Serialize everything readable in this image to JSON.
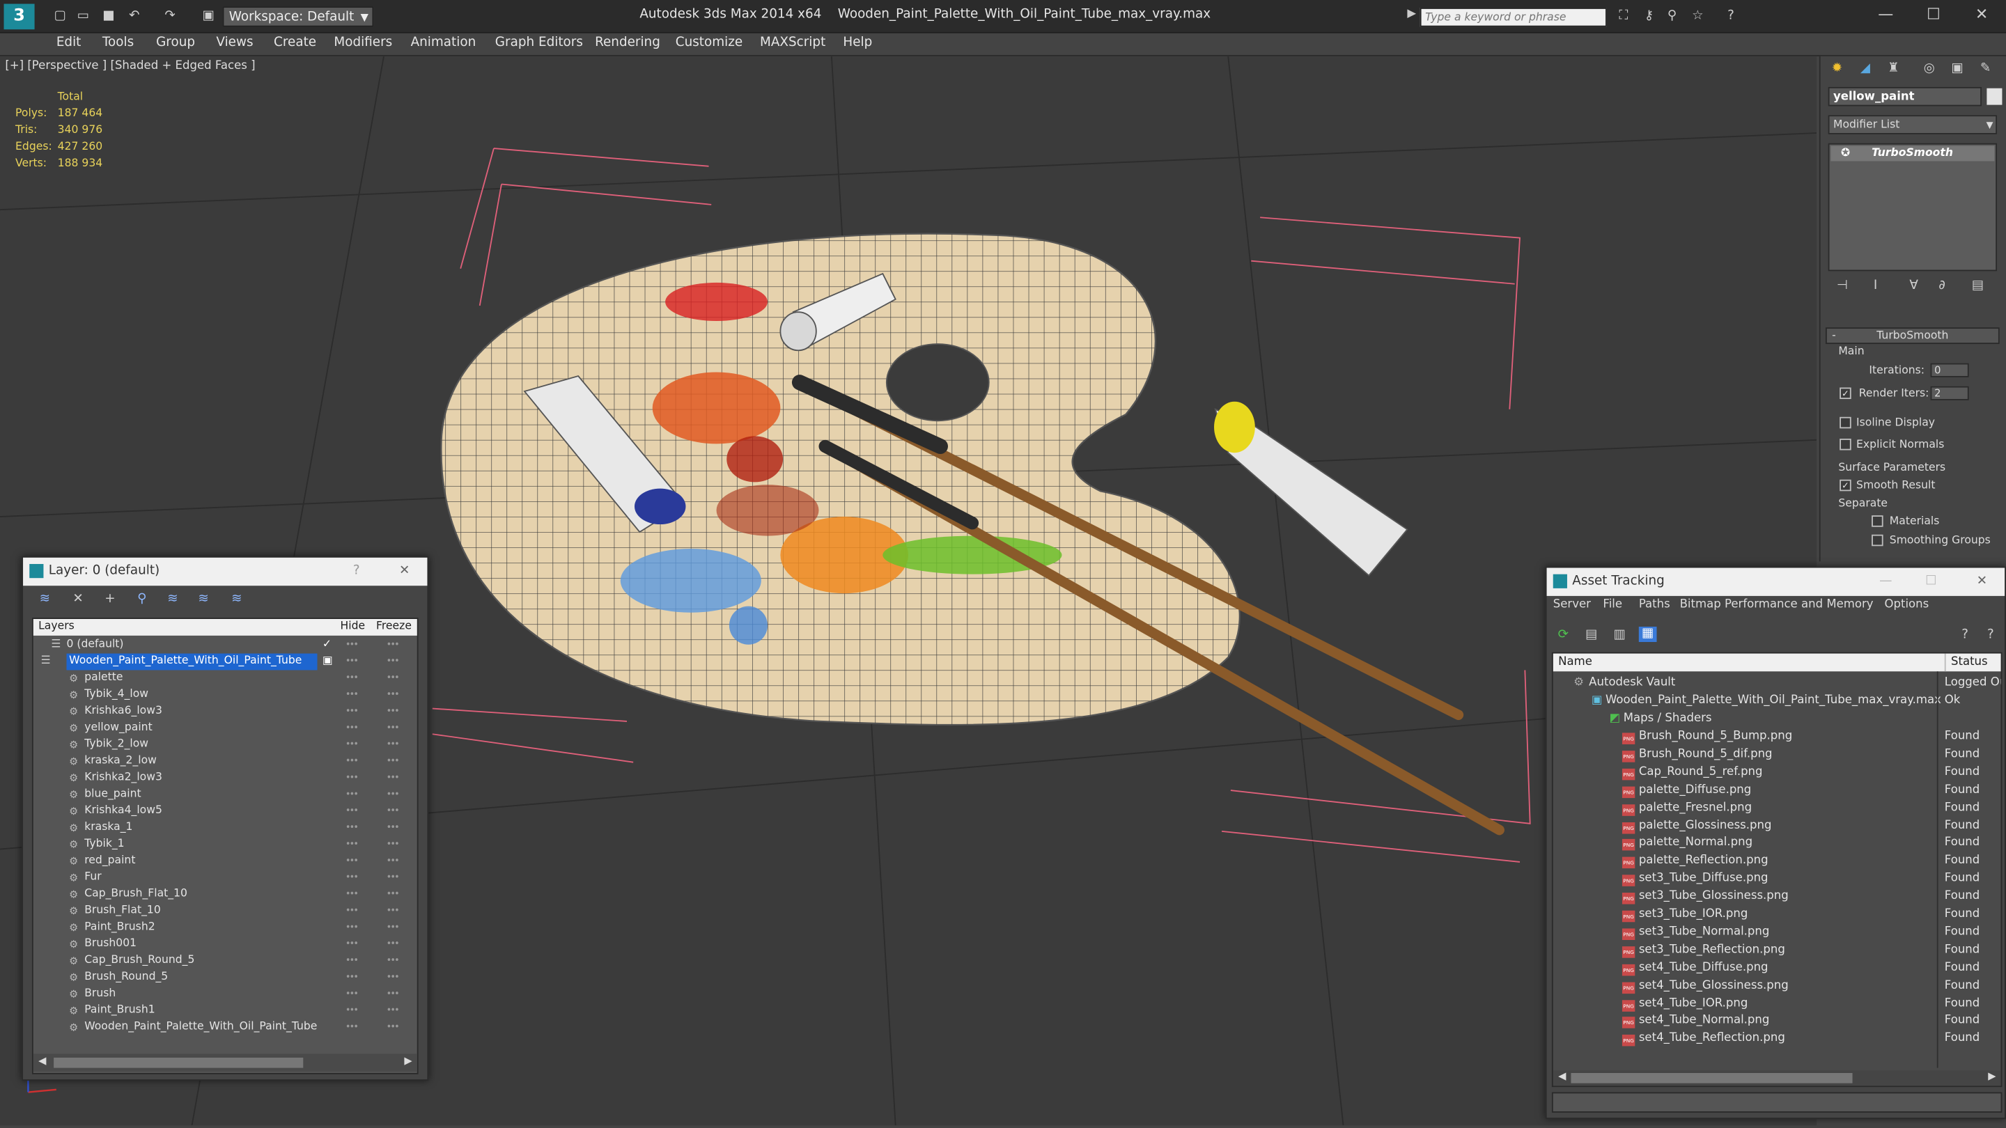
{
  "app": {
    "title": "Autodesk 3ds Max  2014 x64",
    "file": "Wooden_Paint_Palette_With_Oil_Paint_Tube_max_vray.max",
    "workspace": "Workspace: Default",
    "search_placeholder": "Type a keyword or phrase"
  },
  "menus": [
    "Edit",
    "Tools",
    "Group",
    "Views",
    "Create",
    "Modifiers",
    "Animation",
    "Graph Editors",
    "Rendering",
    "Customize",
    "MAXScript",
    "Help"
  ],
  "viewport": {
    "label": "[+] [Perspective ] [Shaded + Edged Faces ]",
    "stats_header": "Total",
    "stats": [
      {
        "label": "Polys:",
        "value": "187 464"
      },
      {
        "label": "Tris:",
        "value": "340 976"
      },
      {
        "label": "Edges:",
        "value": "427 260"
      },
      {
        "label": "Verts:",
        "value": "188 934"
      }
    ]
  },
  "command_panel": {
    "object_name": "yellow_paint",
    "modifier_list": "Modifier List",
    "stack_item": "TurboSmooth",
    "rollout_title": "TurboSmooth",
    "main_label": "Main",
    "iterations_label": "Iterations:",
    "iterations_value": "0",
    "render_iters_label": "Render Iters:",
    "render_iters_value": "2",
    "isoline": "Isoline Display",
    "explicit": "Explicit Normals",
    "surface": "Surface Parameters",
    "smooth_result": "Smooth Result",
    "separate": "Separate",
    "materials": "Materials",
    "smoothing_groups": "Smoothing Groups"
  },
  "layer_window": {
    "title": "Layer: 0 (default)",
    "col_layers": "Layers",
    "col_hide": "Hide",
    "col_freeze": "Freeze",
    "layers": [
      "0 (default)",
      "Wooden_Paint_Palette_With_Oil_Paint_Tube"
    ],
    "objects": [
      "palette",
      "Tybik_4_low",
      "Krishka6_low3",
      "yellow_paint",
      "Tybik_2_low",
      "kraska_2_low",
      "Krishka2_low3",
      "blue_paint",
      "Krishka4_low5",
      "kraska_1",
      "Tybik_1",
      "red_paint",
      "Fur",
      "Cap_Brush_Flat_10",
      "Brush_Flat_10",
      "Paint_Brush2",
      "Brush001",
      "Cap_Brush_Round_5",
      "Brush_Round_5",
      "Brush",
      "Paint_Brush1",
      "Wooden_Paint_Palette_With_Oil_Paint_Tube"
    ]
  },
  "asset_window": {
    "title": "Asset Tracking",
    "menus": [
      "Server",
      "File",
      "Paths",
      "Bitmap Performance and Memory",
      "Options"
    ],
    "col_name": "Name",
    "col_status": "Status",
    "vault": {
      "name": "Autodesk Vault",
      "status": "Logged Ou"
    },
    "file": {
      "name": "Wooden_Paint_Palette_With_Oil_Paint_Tube_max_vray.max",
      "status": "Ok"
    },
    "group": "Maps / Shaders",
    "maps": [
      "Brush_Round_5_Bump.png",
      "Brush_Round_5_dif.png",
      "Cap_Round_5_ref.png",
      "palette_Diffuse.png",
      "palette_Fresnel.png",
      "palette_Glossiness.png",
      "palette_Normal.png",
      "palette_Reflection.png",
      "set3_Tube_Diffuse.png",
      "set3_Tube_Glossiness.png",
      "set3_Tube_IOR.png",
      "set3_Tube_Normal.png",
      "set3_Tube_Reflection.png",
      "set4_Tube_Diffuse.png",
      "set4_Tube_Glossiness.png",
      "set4_Tube_IOR.png",
      "set4_Tube_Normal.png",
      "set4_Tube_Reflection.png"
    ],
    "found": "Found"
  },
  "colors": {
    "selection": "#1e66d0",
    "stats": "#e8d25a",
    "yellow_tube": "#e8d81e",
    "palette_wood": "#e8d4b0"
  }
}
